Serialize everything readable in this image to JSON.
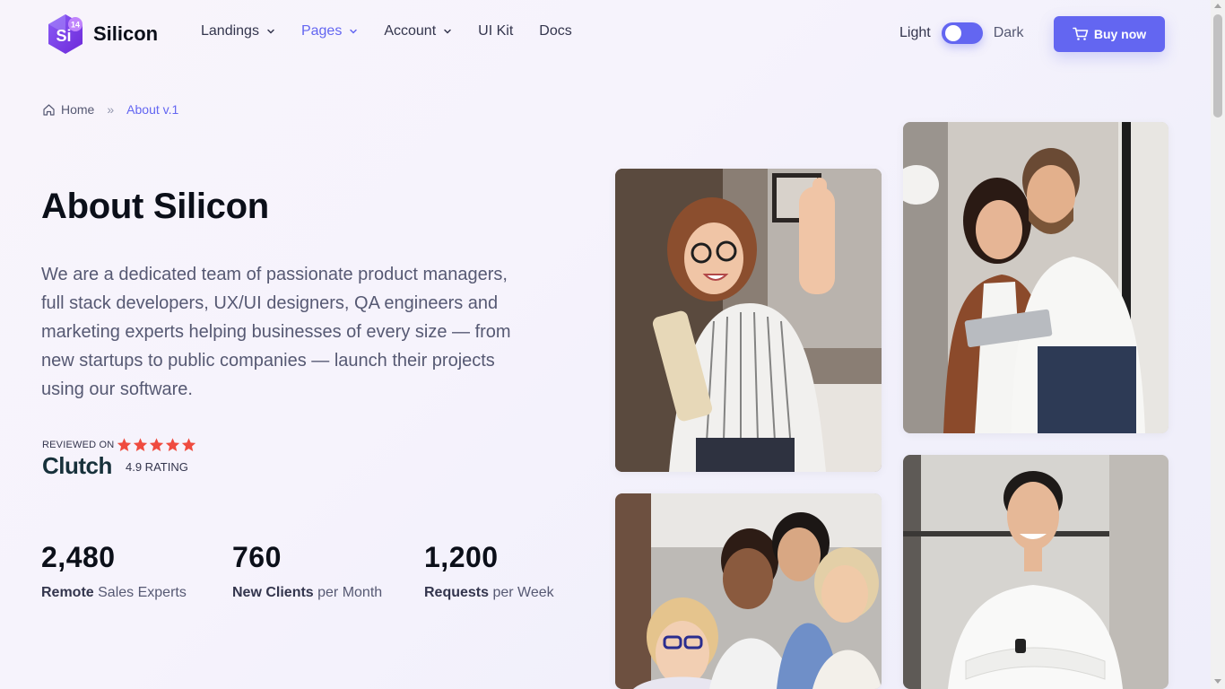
{
  "brand": {
    "name": "Silicon",
    "badge_text": "Si",
    "badge_number": "14"
  },
  "nav": {
    "items": [
      {
        "label": "Landings",
        "dropdown": true
      },
      {
        "label": "Pages",
        "dropdown": true,
        "active": true
      },
      {
        "label": "Account",
        "dropdown": true
      },
      {
        "label": "UI Kit",
        "dropdown": false
      },
      {
        "label": "Docs",
        "dropdown": false
      }
    ]
  },
  "theme": {
    "light_label": "Light",
    "dark_label": "Dark"
  },
  "buy_button": {
    "label": "Buy now",
    "icon": "cart-icon"
  },
  "breadcrumb": {
    "home": "Home",
    "separator": "»",
    "current": "About v.1"
  },
  "hero": {
    "title": "About Silicon",
    "lead": "We are a dedicated team of passionate product managers, full stack developers, UX/UI designers, QA engineers and marketing experts helping businesses of every size — from new startups to public companies — launch their projects using our software."
  },
  "clutch": {
    "reviewed_on": "REVIEWED ON",
    "logo_text": "Clutch",
    "rating": "4.9 RATING",
    "stars": 5
  },
  "stats": [
    {
      "number": "2,480",
      "bold": "Remote",
      "rest": " Sales Experts"
    },
    {
      "number": "760",
      "bold": "New Clients",
      "rest": " per Month"
    },
    {
      "number": "1,200",
      "bold": "Requests",
      "rest": " per Week"
    }
  ],
  "colors": {
    "primary": "#6366f1",
    "heading": "#0b0f19",
    "body": "#565973",
    "star": "#ef4b3f"
  },
  "photos": [
    {
      "name": "photo-woman-thumbs-up"
    },
    {
      "name": "photo-colleagues-tablet"
    },
    {
      "name": "photo-group-smiling"
    },
    {
      "name": "photo-man-arms-crossed"
    }
  ]
}
